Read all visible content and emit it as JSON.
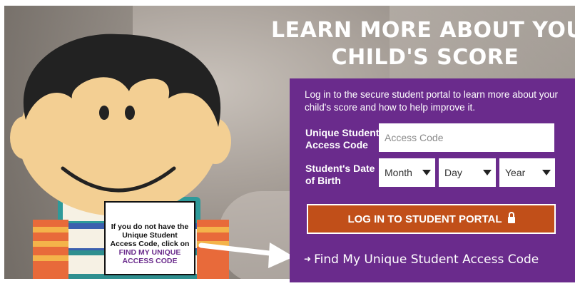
{
  "headline": {
    "line1": "LEARN MORE ABOUT YOUR",
    "line2": "CHILD'S SCORE"
  },
  "panel": {
    "intro": "Log in to the secure student portal to learn more about your child's score and how to help improve it.",
    "access_label": "Unique Student Access Code",
    "access_placeholder": "Access Code",
    "dob_label": "Student's Date of Birth",
    "month": "Month",
    "day": "Day",
    "year": "Year",
    "login_button": "LOG IN TO STUDENT PORTAL",
    "find_link": "Find My Unique Student Access Code"
  },
  "callout": {
    "text": "If you do not have the Unique Student Access Code, click on ",
    "link": "FIND MY UNIQUE ACCESS CODE"
  },
  "colors": {
    "panel": "#6a2b8c",
    "button": "#c14f19"
  },
  "icons": [
    "lock-icon",
    "arrow-right-icon",
    "dropdown-arrow-icon"
  ]
}
